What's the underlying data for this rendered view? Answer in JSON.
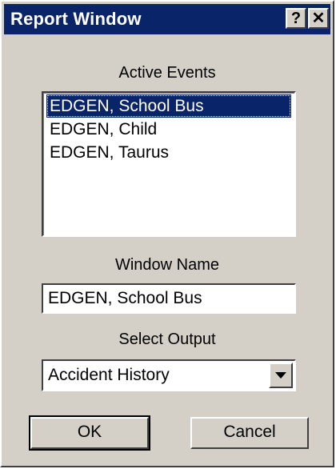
{
  "window": {
    "title": "Report Window",
    "help_label": "?",
    "close_label": "✕"
  },
  "active_events": {
    "label": "Active Events",
    "items": [
      {
        "label": "EDGEN, School Bus",
        "selected": true
      },
      {
        "label": "EDGEN, Child",
        "selected": false
      },
      {
        "label": "EDGEN, Taurus",
        "selected": false
      }
    ]
  },
  "window_name": {
    "label": "Window Name",
    "value": "EDGEN, School Bus"
  },
  "select_output": {
    "label": "Select Output",
    "value": "Accident History"
  },
  "buttons": {
    "ok": "OK",
    "cancel": "Cancel"
  },
  "colors": {
    "titlebar": "#0a246a",
    "face": "#d4d0c8",
    "selection": "#0a246a"
  }
}
